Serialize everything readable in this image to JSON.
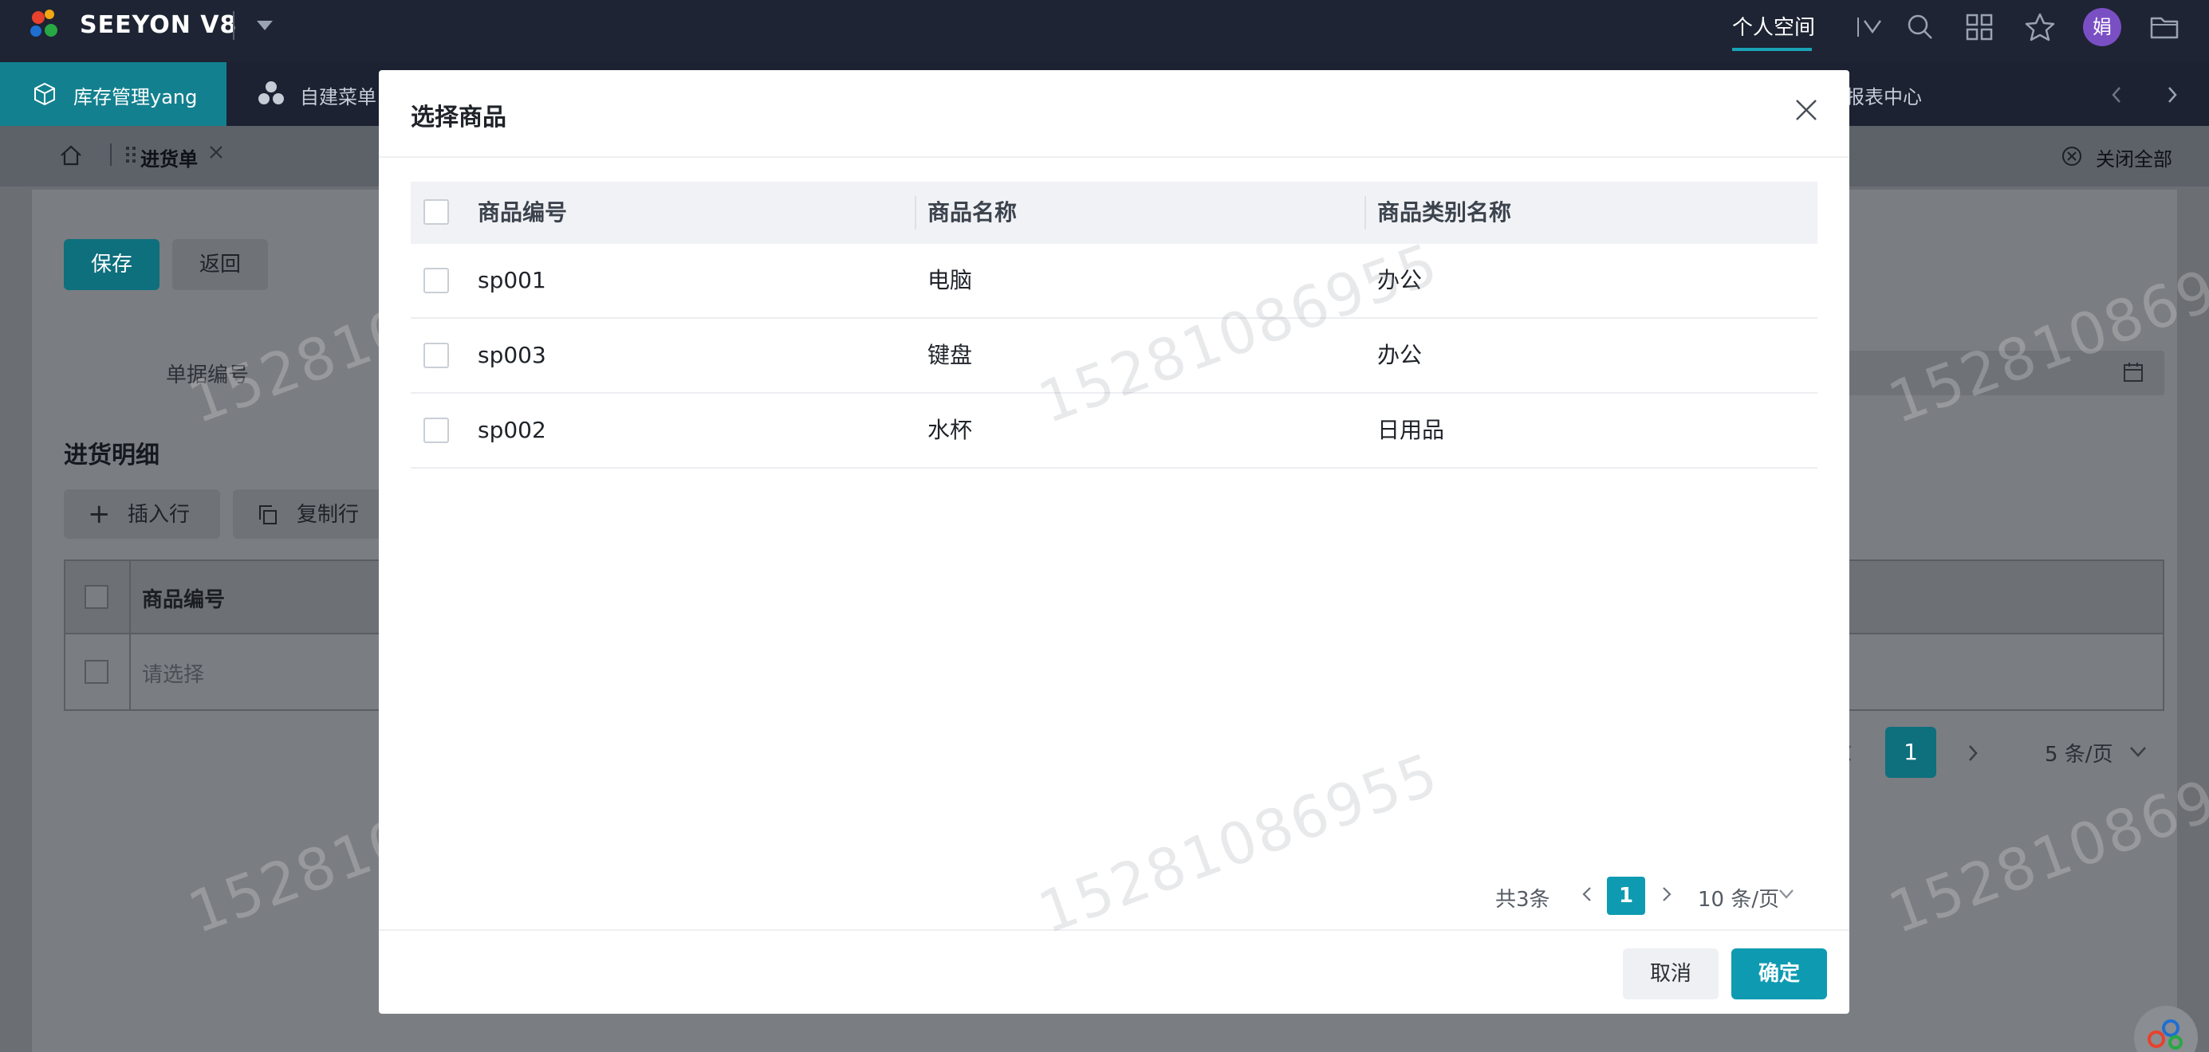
{
  "app": {
    "brand": "SEEYON V8",
    "personal_space": "个人空间",
    "avatar_text": "娟",
    "accent_color": "#0e9bb1"
  },
  "app_tabs": {
    "active": "库存管理yang",
    "custom_menu": "自建菜单",
    "report_center": "报表中心"
  },
  "breadcrumb": {
    "current_tab": "进货单",
    "close_all": "关闭全部"
  },
  "form": {
    "save": "保存",
    "back": "返回",
    "doc_number_label": "单据编号",
    "detail_title": "进货明细",
    "insert_row": "插入行",
    "copy_row": "复制行",
    "column_product_code": "商品编号",
    "row_placeholder": "请选择",
    "page": "1",
    "page_size": "5 条/页"
  },
  "watermark": "15281086955",
  "modal": {
    "title": "选择商品",
    "columns": [
      "商品编号",
      "商品名称",
      "商品类别名称"
    ],
    "rows": [
      {
        "code": "sp001",
        "name": "电脑",
        "category": "办公"
      },
      {
        "code": "sp003",
        "name": "键盘",
        "category": "办公"
      },
      {
        "code": "sp002",
        "name": "水杯",
        "category": "日用品"
      }
    ],
    "pager": {
      "total": "共3条",
      "page": "1",
      "page_size": "10 条/页"
    },
    "cancel": "取消",
    "confirm": "确定"
  }
}
